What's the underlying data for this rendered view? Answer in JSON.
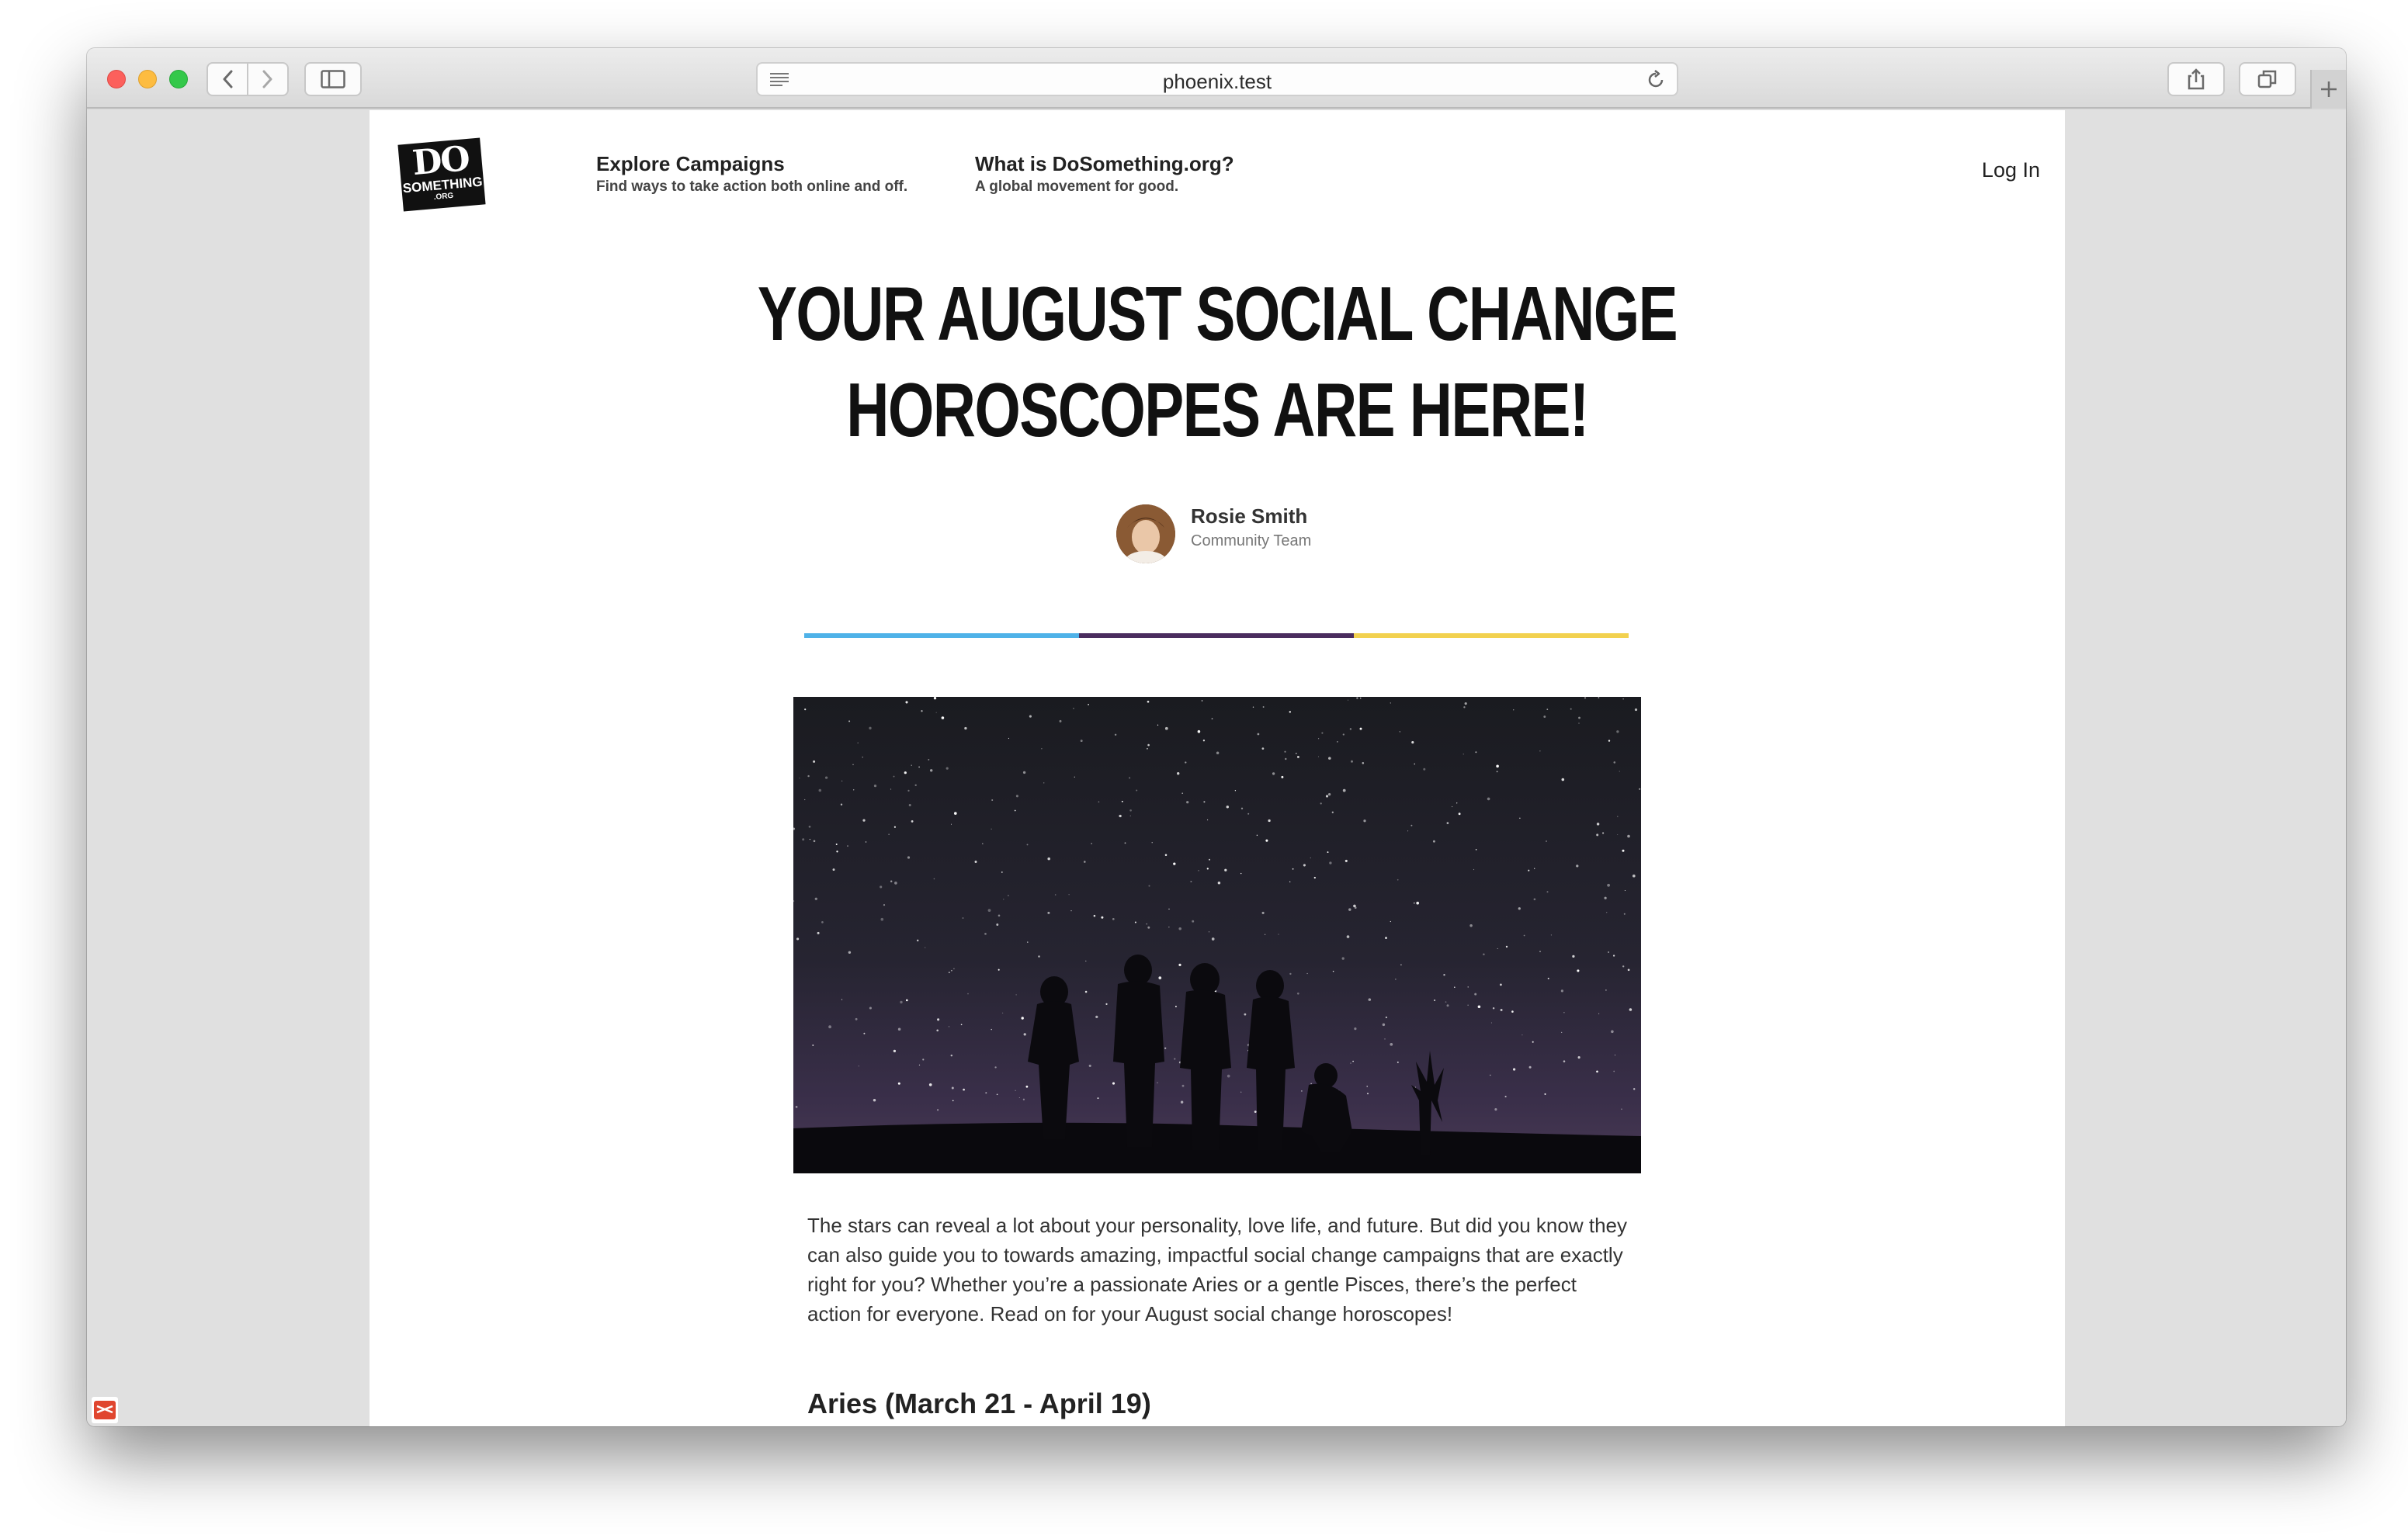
{
  "browser": {
    "url": "phoenix.test",
    "icons": [
      "close-dot",
      "minimize-dot",
      "maximize-dot",
      "back-icon",
      "forward-icon",
      "sidebar-icon",
      "reader-icon",
      "reload-icon",
      "share-icon",
      "tabs-icon",
      "plus-icon"
    ]
  },
  "site": {
    "logo": {
      "line1": "DO",
      "line2": "SOMETHING",
      "line3": ".ORG"
    },
    "nav": [
      {
        "title": "Explore Campaigns",
        "subtitle": "Find ways to take action both online and off."
      },
      {
        "title": "What is DoSomething.org?",
        "subtitle": "A global movement for good."
      }
    ],
    "login": "Log In"
  },
  "article": {
    "title_line1": "YOUR AUGUST SOCIAL CHANGE",
    "title_line2": "HOROSCOPES ARE HERE!",
    "author": {
      "name": "Rosie Smith",
      "role": "Community Team"
    },
    "rule_colors": [
      "#4fb2e8",
      "#4a2c5e",
      "#f2d14f"
    ],
    "intro": "The stars can reveal a lot about your personality, love life, and future. But did you know they can also guide you to towards amazing, impactful social change campaigns that are exactly right for you? Whether you’re a passionate Aries or a gentle Pisces, there’s the perfect action for everyone. Read on for your August social change horoscopes!",
    "first_heading": "Aries (March 21 - April 19)"
  }
}
